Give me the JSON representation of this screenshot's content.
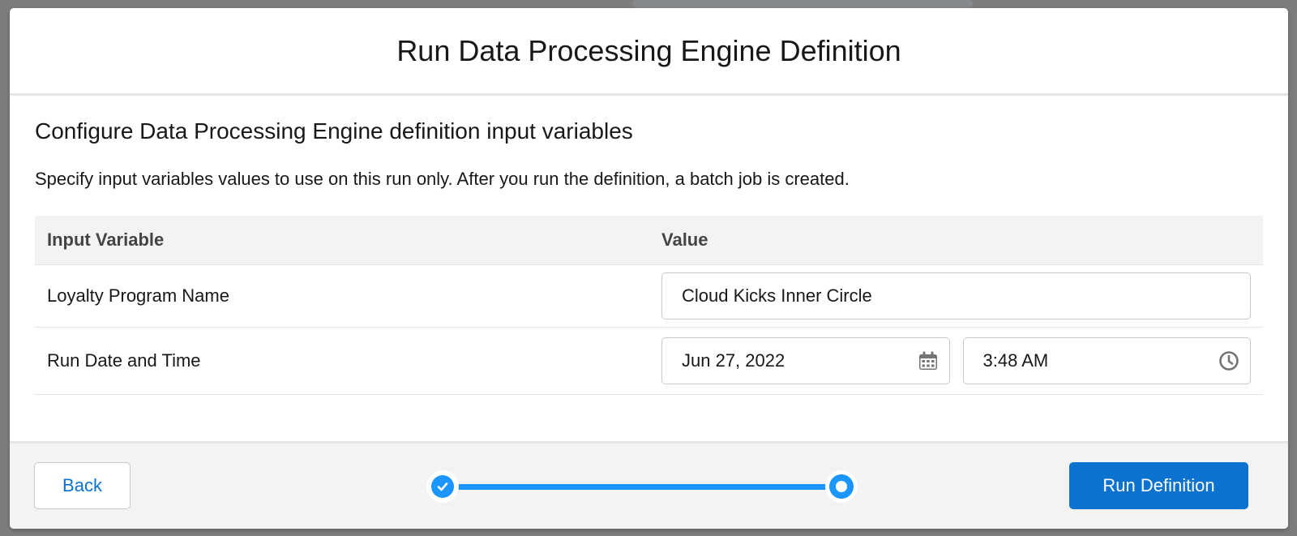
{
  "modal": {
    "title": "Run Data Processing Engine Definition"
  },
  "body": {
    "heading": "Configure Data Processing Engine definition input variables",
    "description": "Specify input variables values to use on this run only. After you run the definition, a batch job is created."
  },
  "table": {
    "columns": [
      "Input Variable",
      "Value"
    ],
    "rows": [
      {
        "variable": "Loyalty Program Name",
        "value": "Cloud Kicks Inner Circle"
      },
      {
        "variable": "Run Date and Time",
        "date": "Jun 27, 2022",
        "time": "3:48 AM"
      }
    ]
  },
  "icons": {
    "date": "calendar-icon",
    "time": "clock-icon",
    "step_complete": "check-icon"
  },
  "progress": {
    "total_steps": 2,
    "completed_steps": 1,
    "current_step": 2
  },
  "footer": {
    "back_label": "Back",
    "run_label": "Run Definition"
  },
  "colors": {
    "brand": "#0b72cf",
    "progress": "#1b96ff",
    "footer_bg": "#f3f3f3",
    "overlay": "#7d7d7d"
  }
}
